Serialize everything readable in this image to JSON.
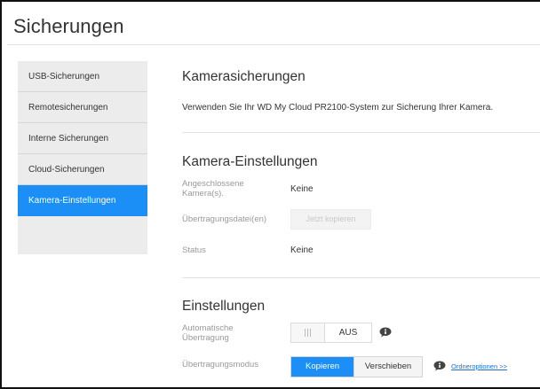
{
  "page_title": "Sicherungen",
  "sidebar": {
    "items": [
      {
        "label": "USB-Sicherungen",
        "active": false
      },
      {
        "label": "Remotesicherungen",
        "active": false
      },
      {
        "label": "Interne Sicherungen",
        "active": false
      },
      {
        "label": "Cloud-Sicherungen",
        "active": false
      },
      {
        "label": "Kamera-Einstellungen",
        "active": true
      }
    ]
  },
  "camera_backups": {
    "heading": "Kamerasicherungen",
    "description": "Verwenden Sie Ihr WD My Cloud PR2100-System zur Sicherung Ihrer Kamera."
  },
  "camera_settings": {
    "heading": "Kamera-Einstellungen",
    "connected_label_line1": "Angeschlossene",
    "connected_label_line2": "Kamera(s).",
    "connected_value": "Keine",
    "transfer_files_label": "Übertragungsdatei(en)",
    "copy_now_button": "Jetzt kopieren",
    "status_label": "Status",
    "status_value": "Keine"
  },
  "settings": {
    "heading": "Einstellungen",
    "auto_transfer_label_line1": "Automatische",
    "auto_transfer_label_line2": "Übertragung",
    "auto_transfer_state": "AUS",
    "transfer_mode_label": "Übertragungsmodus",
    "mode_options": [
      "Kopieren",
      "Verschieben"
    ],
    "mode_selected": "Kopieren",
    "folder_options_link": "Ordneroptionen >>"
  },
  "colors": {
    "accent": "#1b8ff5",
    "sidebar_bg": "#ececec",
    "link": "#1b6fd6"
  }
}
